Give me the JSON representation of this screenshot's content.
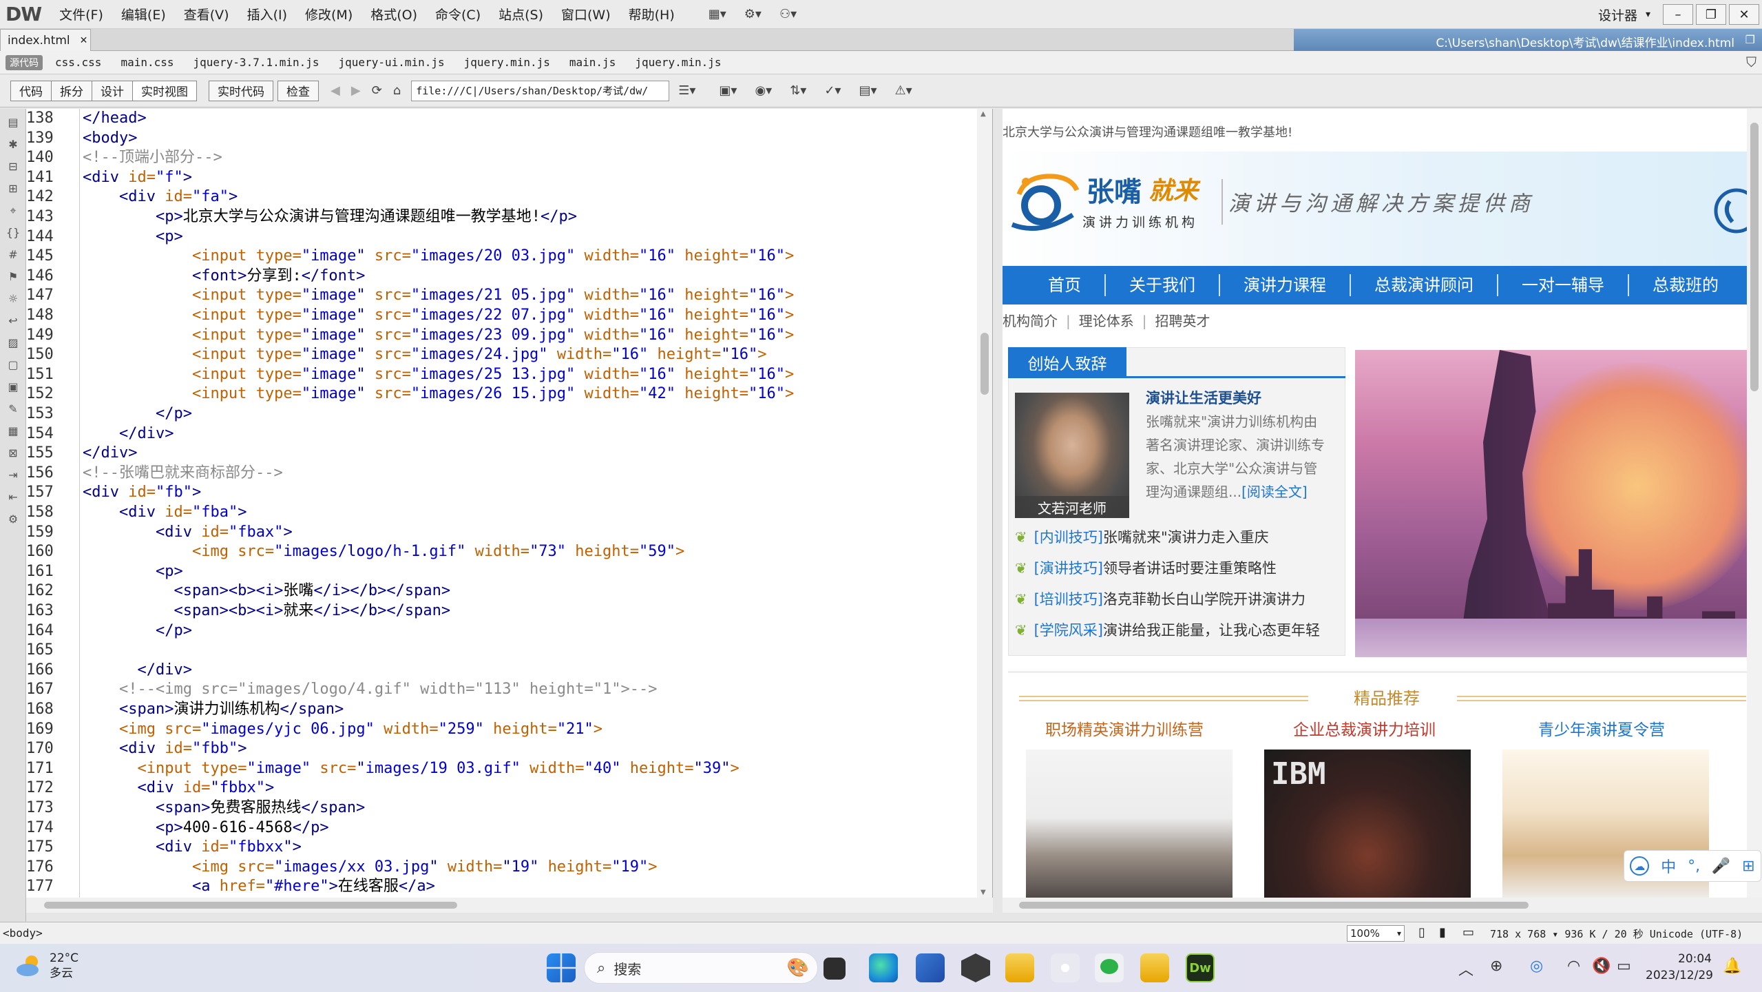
{
  "app": {
    "logo": "DW",
    "menu": [
      "文件(F)",
      "编辑(E)",
      "查看(V)",
      "插入(I)",
      "修改(M)",
      "格式(O)",
      "命令(C)",
      "站点(S)",
      "窗口(W)",
      "帮助(H)"
    ],
    "workspace": "设计器"
  },
  "doc_tab": {
    "name": "index.html",
    "path": "C:\\Users\\shan\\Desktop\\考试\\dw\\结课作业\\index.html"
  },
  "related_files": {
    "source_label": "源代码",
    "files": [
      "css.css",
      "main.css",
      "jquery-3.7.1.min.js",
      "jquery-ui.min.js",
      "jquery.min.js",
      "main.js",
      "jquery.min.js"
    ]
  },
  "doc_toolbar": {
    "views": [
      "代码",
      "拆分",
      "设计",
      "实时视图"
    ],
    "live_buttons": [
      "实时代码",
      "检查"
    ],
    "address": "file:///C|/Users/shan/Desktop/考试/dw/"
  },
  "code": {
    "lines": [
      {
        "n": "138",
        "html": "<span class=\"tg\">&lt;/head&gt;</span>"
      },
      {
        "n": "139",
        "html": "<span class=\"tg\">&lt;body&gt;</span>"
      },
      {
        "n": "140",
        "html": "<span class=\"cm\">&lt;!--顶端小部分--&gt;</span>"
      },
      {
        "n": "141",
        "html": "<span class=\"tg\">&lt;div</span> <span class=\"at\">id=</span><span class=\"st\">\"f\"</span><span class=\"tg\">&gt;</span>"
      },
      {
        "n": "142",
        "html": "    <span class=\"tg\">&lt;div</span> <span class=\"at\">id=</span><span class=\"st\">\"fa\"</span><span class=\"tg\">&gt;</span>"
      },
      {
        "n": "143",
        "html": "        <span class=\"tg\">&lt;p&gt;</span>北京大学与公众演讲与管理沟通课题组唯一教学基地!<span class=\"tg\">&lt;/p&gt;</span>"
      },
      {
        "n": "144",
        "html": "        <span class=\"tg\">&lt;p&gt;</span>"
      },
      {
        "n": "145",
        "html": "            <span class=\"at\">&lt;input</span> <span class=\"at\">type=</span><span class=\"st\">\"image\"</span> <span class=\"at\">src=</span><span class=\"st\">\"images/20 03.jpg\"</span> <span class=\"at\">width=</span><span class=\"st\">\"16\"</span> <span class=\"at\">height=</span><span class=\"st\">\"16\"</span><span class=\"at\">&gt;</span>"
      },
      {
        "n": "146",
        "html": "            <span class=\"tg\">&lt;font&gt;</span>分享到:<span class=\"tg\">&lt;/font&gt;</span>"
      },
      {
        "n": "147",
        "html": "            <span class=\"at\">&lt;input</span> <span class=\"at\">type=</span><span class=\"st\">\"image\"</span> <span class=\"at\">src=</span><span class=\"st\">\"images/21 05.jpg\"</span> <span class=\"at\">width=</span><span class=\"st\">\"16\"</span> <span class=\"at\">height=</span><span class=\"st\">\"16\"</span><span class=\"at\">&gt;</span>"
      },
      {
        "n": "148",
        "html": "            <span class=\"at\">&lt;input</span> <span class=\"at\">type=</span><span class=\"st\">\"image\"</span> <span class=\"at\">src=</span><span class=\"st\">\"images/22 07.jpg\"</span> <span class=\"at\">width=</span><span class=\"st\">\"16\"</span> <span class=\"at\">height=</span><span class=\"st\">\"16\"</span><span class=\"at\">&gt;</span>"
      },
      {
        "n": "149",
        "html": "            <span class=\"at\">&lt;input</span> <span class=\"at\">type=</span><span class=\"st\">\"image\"</span> <span class=\"at\">src=</span><span class=\"st\">\"images/23 09.jpg\"</span> <span class=\"at\">width=</span><span class=\"st\">\"16\"</span> <span class=\"at\">height=</span><span class=\"st\">\"16\"</span><span class=\"at\">&gt;</span>"
      },
      {
        "n": "150",
        "html": "            <span class=\"at\">&lt;input</span> <span class=\"at\">type=</span><span class=\"st\">\"image\"</span> <span class=\"at\">src=</span><span class=\"st\">\"images/24.jpg\"</span> <span class=\"at\">width=</span><span class=\"st\">\"16\"</span> <span class=\"at\">height=</span><span class=\"st\">\"16\"</span><span class=\"at\">&gt;</span>"
      },
      {
        "n": "151",
        "html": "            <span class=\"at\">&lt;input</span> <span class=\"at\">type=</span><span class=\"st\">\"image\"</span> <span class=\"at\">src=</span><span class=\"st\">\"images/25 13.jpg\"</span> <span class=\"at\">width=</span><span class=\"st\">\"16\"</span> <span class=\"at\">height=</span><span class=\"st\">\"16\"</span><span class=\"at\">&gt;</span>"
      },
      {
        "n": "152",
        "html": "            <span class=\"at\">&lt;input</span> <span class=\"at\">type=</span><span class=\"st\">\"image\"</span> <span class=\"at\">src=</span><span class=\"st\">\"images/26 15.jpg\"</span> <span class=\"at\">width=</span><span class=\"st\">\"42\"</span> <span class=\"at\">height=</span><span class=\"st\">\"16\"</span><span class=\"at\">&gt;</span>"
      },
      {
        "n": "153",
        "html": "        <span class=\"tg\">&lt;/p&gt;</span>"
      },
      {
        "n": "154",
        "html": "    <span class=\"tg\">&lt;/div&gt;</span>"
      },
      {
        "n": "155",
        "html": "<span class=\"tg\">&lt;/div&gt;</span>"
      },
      {
        "n": "156",
        "html": "<span class=\"cm\">&lt;!--张嘴巴就来商标部分--&gt;</span>"
      },
      {
        "n": "157",
        "html": "<span class=\"tg\">&lt;div</span> <span class=\"at\">id=</span><span class=\"st\">\"fb\"</span><span class=\"tg\">&gt;</span>"
      },
      {
        "n": "158",
        "html": "    <span class=\"tg\">&lt;div</span> <span class=\"at\">id=</span><span class=\"st\">\"fba\"</span><span class=\"tg\">&gt;</span>"
      },
      {
        "n": "159",
        "html": "        <span class=\"tg\">&lt;div</span> <span class=\"at\">id=</span><span class=\"st\">\"fbax\"</span><span class=\"tg\">&gt;</span>"
      },
      {
        "n": "160",
        "html": "            <span class=\"at\">&lt;img</span> <span class=\"at\">src=</span><span class=\"st\">\"images/logo/h-1.gif\"</span> <span class=\"at\">width=</span><span class=\"st\">\"73\"</span> <span class=\"at\">height=</span><span class=\"st\">\"59\"</span><span class=\"at\">&gt;</span>"
      },
      {
        "n": "161",
        "html": "        <span class=\"tg\">&lt;p&gt;</span>"
      },
      {
        "n": "162",
        "html": "          <span class=\"tg\">&lt;span&gt;&lt;b&gt;&lt;i&gt;</span>张嘴<span class=\"tg\">&lt;/i&gt;&lt;/b&gt;&lt;/span&gt;</span>"
      },
      {
        "n": "163",
        "html": "          <span class=\"tg\">&lt;span&gt;&lt;b&gt;&lt;i&gt;</span>就来<span class=\"tg\">&lt;/i&gt;&lt;/b&gt;&lt;/span&gt;</span>"
      },
      {
        "n": "164",
        "html": "        <span class=\"tg\">&lt;/p&gt;</span>"
      },
      {
        "n": "165",
        "html": ""
      },
      {
        "n": "166",
        "html": "      <span class=\"tg\">&lt;/div&gt;</span>"
      },
      {
        "n": "167",
        "html": "    <span class=\"cm\">&lt;!--&lt;img src=\"images/logo/4.gif\" width=\"113\" height=\"1\"&gt;--&gt;</span>"
      },
      {
        "n": "168",
        "html": "    <span class=\"tg\">&lt;span&gt;</span>演讲力训练机构<span class=\"tg\">&lt;/span&gt;</span>"
      },
      {
        "n": "169",
        "html": "    <span class=\"at\">&lt;img</span> <span class=\"at\">src=</span><span class=\"st\">\"images/yjc 06.jpg\"</span> <span class=\"at\">width=</span><span class=\"st\">\"259\"</span> <span class=\"at\">height=</span><span class=\"st\">\"21\"</span><span class=\"at\">&gt;</span>"
      },
      {
        "n": "170",
        "html": "    <span class=\"tg\">&lt;div</span> <span class=\"at\">id=</span><span class=\"st\">\"fbb\"</span><span class=\"tg\">&gt;</span>"
      },
      {
        "n": "171",
        "html": "      <span class=\"at\">&lt;input</span> <span class=\"at\">type=</span><span class=\"st\">\"image\"</span> <span class=\"at\">src=</span><span class=\"st\">\"images/19 03.gif\"</span> <span class=\"at\">width=</span><span class=\"st\">\"40\"</span> <span class=\"at\">height=</span><span class=\"st\">\"39\"</span><span class=\"at\">&gt;</span>"
      },
      {
        "n": "172",
        "html": "      <span class=\"tg\">&lt;div</span> <span class=\"at\">id=</span><span class=\"st\">\"fbbx\"</span><span class=\"tg\">&gt;</span>"
      },
      {
        "n": "173",
        "html": "        <span class=\"tg\">&lt;span&gt;</span>免费客服热线<span class=\"tg\">&lt;/span&gt;</span>"
      },
      {
        "n": "174",
        "html": "        <span class=\"tg\">&lt;p&gt;</span>400-616-4568<span class=\"tg\">&lt;/p&gt;</span>"
      },
      {
        "n": "175",
        "html": "        <span class=\"tg\">&lt;div</span> <span class=\"at\">id=</span><span class=\"st\">\"fbbxx\"</span><span class=\"tg\">&gt;</span>"
      },
      {
        "n": "176",
        "html": "            <span class=\"at\">&lt;img</span> <span class=\"at\">src=</span><span class=\"st\">\"images/xx 03.jpg\"</span> <span class=\"at\">width=</span><span class=\"st\">\"19\"</span> <span class=\"at\">height=</span><span class=\"st\">\"19\"</span><span class=\"at\">&gt;</span>"
      },
      {
        "n": "177",
        "html": "            <span class=\"tg\">&lt;a</span> <span class=\"at\">href=</span><span class=\"st\">\"#here\"</span><span class=\"tg\">&gt;</span>在线客服<span class=\"tg\">&lt;/a&gt;</span>"
      }
    ]
  },
  "live": {
    "top_text": "北京大学与公众演讲与管理沟通课题组唯一教学基地!",
    "brand1": "张嘴",
    "brand2": "就来",
    "brand_sub": "演讲力训练机构",
    "slogan": "演讲与沟通解决方案提供商",
    "nav": [
      "首页",
      "关于我们",
      "演讲力课程",
      "总裁演讲顾问",
      "一对一辅导",
      "总裁班的"
    ],
    "sub_nav": [
      "机构简介",
      "理论体系",
      "招聘英才"
    ],
    "founder_tab": "创始人致辞",
    "photo_caption": "文若河老师",
    "speech_title": "演讲让生活更美好",
    "speech_lines": [
      "张嘴就来\"演讲力训练机构由",
      "著名演讲理论家、演讲训练专",
      "家、北京大学\"公众演讲与管",
      "理沟通课题组..."
    ],
    "read_more": "[阅读全文]",
    "news": [
      {
        "cat": "[内训技巧]",
        "title": "张嘴就来\"演讲力走入重庆"
      },
      {
        "cat": "[演讲技巧]",
        "title": "领导者讲话时要注重策略性"
      },
      {
        "cat": "[培训技巧]",
        "title": "洛克菲勒长白山学院开讲演讲力"
      },
      {
        "cat": "[学院风采]",
        "title": "演讲给我正能量，让我心态更年轻"
      }
    ],
    "jingpin": "精品推荐",
    "products": [
      {
        "title": "职场精英演讲力训练营",
        "color": "#c4661c"
      },
      {
        "title": "企业总裁演讲力培训",
        "color": "#c0392b"
      },
      {
        "title": "青少年演讲夏令营",
        "color": "#1d75d2"
      }
    ],
    "ibm_text": "IBM",
    "ime": [
      "中",
      "°,",
      "🎤",
      "⊞"
    ]
  },
  "statusbar": {
    "tag": "<body>",
    "zoom": "100%",
    "info": "718 x 768 ▾  936 K / 20 秒 Unicode (UTF-8)"
  },
  "taskbar": {
    "temp": "22°C",
    "weather": "多云",
    "search": "搜索",
    "time": "20:04",
    "date": "2023/12/29"
  }
}
